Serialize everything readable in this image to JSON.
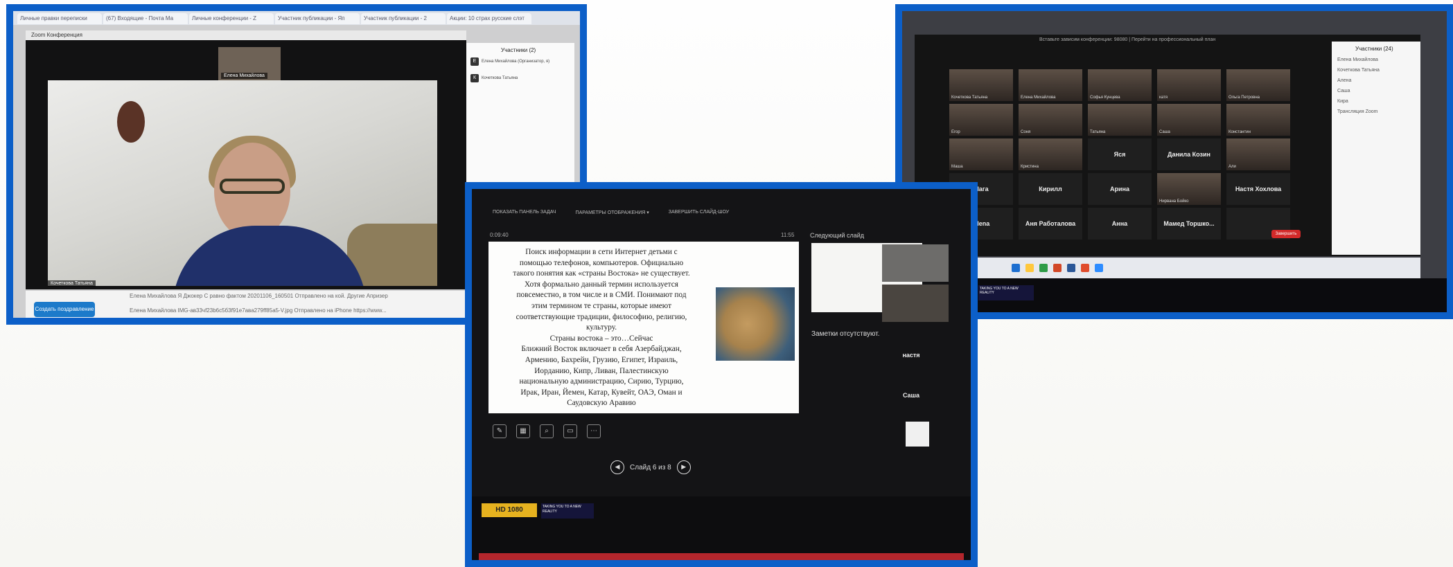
{
  "photo1": {
    "tabs": [
      "Личные правки переписки",
      "(67) Входящие - Почта Ma",
      "Личные конференции - Z",
      "Участник публикации - Яп",
      "Участник публикации - 2",
      "Акции: 10 страх русские слэт"
    ],
    "window_title": "Zoom Конференция",
    "top_video_name": "Елена Михайлова",
    "speaker_name": "Кочеткова Татьяна",
    "participants_title": "Участники (2)",
    "participants": [
      {
        "initial": "Е",
        "name": "Елена Михайлова (Организатор, я)"
      },
      {
        "initial": "К",
        "name": "Кочеткова Татьяна"
      }
    ],
    "chat_lines": [
      "Елена Михайлова    Я Джокер С равно фактом 20201106_160501 Отправлено на кой.  Другие Апризер",
      "Елена Михайлова    IMG-ав33чf23b6с5б3f91е7ава279ff85a5-V.jpg Отправлено на iPhone https://www..."
    ],
    "create_button": "Создать поздравление"
  },
  "photo2": {
    "toolbar": [
      "ПОКАЗАТЬ ПАНЕЛЬ ЗАДАЧ",
      "ПАРАМЕТРЫ ОТОБРАЖЕНИЯ ▾",
      "ЗАВЕРШИТЬ СЛАЙД-ШОУ"
    ],
    "timer": "0:09:40",
    "clock": "11:55",
    "next_slide_label": "Следующий слайд",
    "slide_text_lines": [
      "Поиск информации в сети Интернет детьми с",
      "помощью телефонов, компьютеров. Официально",
      "такого понятия как «страны Востока» не существует.",
      "Хотя формально данный термин используется",
      "повсеместно, в том числе и в СМИ. Понимают под",
      "этим термином те страны, которые имеют",
      "соответствующие традиции, философию, религию,",
      "культуру.",
      "Страны востока – это…Сейчас",
      "Ближний Восток включает в себя Азербайджан,",
      "Армению, Бахрейн, Грузию, Египет, Израиль,",
      "Иорданию, Кипр, Ливан, Палестинскую",
      "национальную администрацию, Сирию, Турцию,",
      "Ирак, Иран, Йемен, Катар, Кувейт, ОАЭ, Оман и",
      "Саудовскую Аравию"
    ],
    "notes": "Заметки отсутствуют.",
    "side_names": [
      "настя",
      "Саша"
    ],
    "slide_counter": "Слайд 6 из 8",
    "hd_label": "HD 1080",
    "sticker": "TAKING YOU TO A NEW REALITY"
  },
  "photo3": {
    "header": "Вставьте зависим конференции: 98080 | Перейти на профессиональный план",
    "participants_title": "Участники (24)",
    "tiles": [
      "Кочеткова Татьяна",
      "Елена Михайлова",
      "Софья Кунцева",
      "катя",
      "Ольга Петровна",
      "Егор",
      "Соня",
      "Татьяна",
      "Саша",
      "Константин",
      "Маша",
      "Кристина",
      "Яся",
      "Данила Козин",
      "Али",
      "Мага",
      "Кирилл",
      "Арина",
      "Нирвана Бойко",
      "Настя Хохлова",
      "Alena",
      "Аня Работалова",
      "Анна",
      "Мамед Торшко...",
      ""
    ],
    "side_items": [
      "Елена Михайлова",
      "Кочеткова Татьяна",
      "Алена",
      "Саша",
      "Кира",
      "Трансляция Zoom"
    ],
    "end_button": "Завершить",
    "sticker": "TAKING YOU TO A NEW REALITY"
  }
}
